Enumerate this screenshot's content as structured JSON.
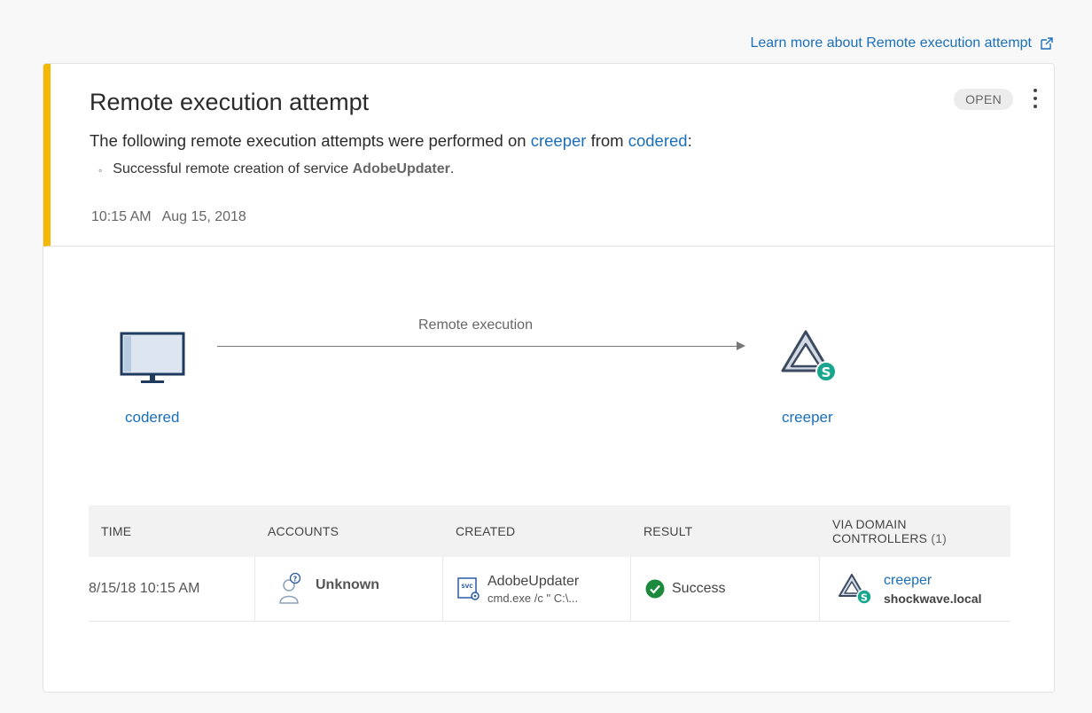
{
  "learn_more": {
    "label": "Learn more about Remote execution attempt",
    "icon": "external-link-icon"
  },
  "alert": {
    "title": "Remote execution attempt",
    "status": "OPEN",
    "accent_color": "#f5b800",
    "description": {
      "prefix": "The following remote execution attempts were performed on ",
      "target": "creeper",
      "middle": " from ",
      "source": "codered",
      "suffix": ":"
    },
    "bullet": {
      "prefix": "Successful remote creation of service ",
      "service": "AdobeUpdater",
      "suffix": "."
    },
    "time": "10:15 AM",
    "date": "Aug 15, 2018"
  },
  "diagram": {
    "source": {
      "label": "codered",
      "icon": "monitor-icon"
    },
    "edge_label": "Remote execution",
    "target": {
      "label": "creeper",
      "icon": "domain-controller-icon"
    }
  },
  "table": {
    "headers": {
      "time": "TIME",
      "accounts": "ACCOUNTS",
      "created": "CREATED",
      "result": "RESULT",
      "via_dc_line1": "VIA DOMAIN",
      "via_dc_line2": "CONTROLLERS",
      "via_dc_count": "(1)"
    },
    "row": {
      "time": "8/15/18 10:15 AM",
      "account": "Unknown",
      "created_name": "AdobeUpdater",
      "created_cmd": "cmd.exe /c \" C:\\...",
      "result": "Success",
      "dc_name": "creeper",
      "dc_domain": "shockwave.local"
    }
  },
  "colors": {
    "link": "#1a6fb8",
    "success": "#1b8a3c",
    "badge_teal": "#1aa58f"
  }
}
